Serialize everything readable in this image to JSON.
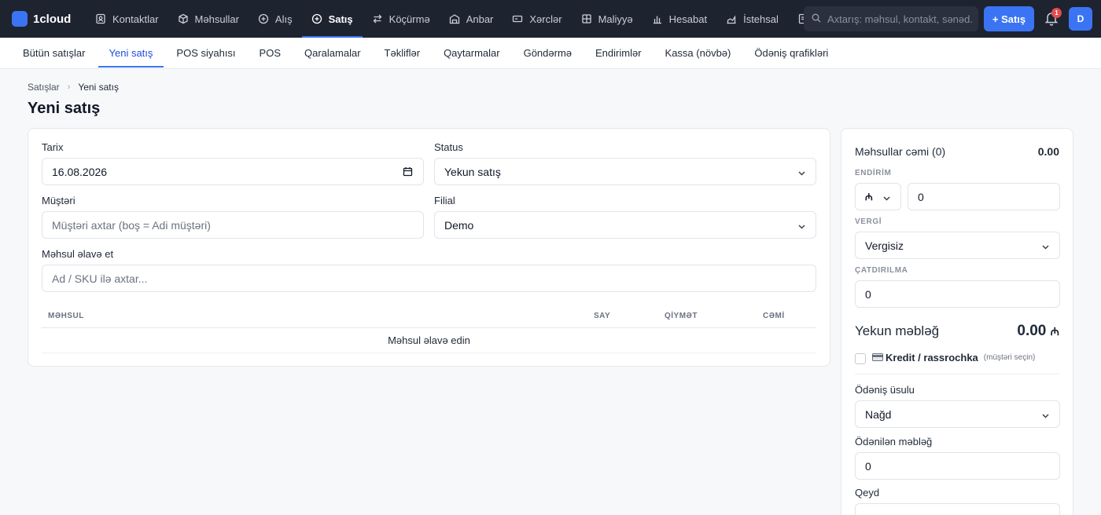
{
  "app": {
    "name": "1cloud"
  },
  "nav": [
    {
      "label": "Kontaktlar",
      "icon": "contacts-icon"
    },
    {
      "label": "Məhsullar",
      "icon": "box-icon"
    },
    {
      "label": "Alış",
      "icon": "plus-circle-icon"
    },
    {
      "label": "Satış",
      "icon": "plus-circle-icon",
      "active": true
    },
    {
      "label": "Köçürmə",
      "icon": "transfer-icon"
    },
    {
      "label": "Anbar",
      "icon": "warehouse-icon"
    },
    {
      "label": "Xərclər",
      "icon": "wallet-icon"
    },
    {
      "label": "Maliyyə",
      "icon": "grid-icon"
    },
    {
      "label": "Hesabat",
      "icon": "bar-chart-icon"
    },
    {
      "label": "İstehsal",
      "icon": "factory-icon"
    }
  ],
  "search": {
    "placeholder": "Axtarış: məhsul, kontakt, sənəd..."
  },
  "header": {
    "new_sale_label": "+ Satış",
    "notification_count": "1",
    "avatar_initial": "D"
  },
  "subnav": [
    {
      "label": "Bütün satışlar"
    },
    {
      "label": "Yeni satış",
      "active": true
    },
    {
      "label": "POS siyahısı"
    },
    {
      "label": "POS"
    },
    {
      "label": "Qaralamalar"
    },
    {
      "label": "Təkliflər"
    },
    {
      "label": "Qaytarmalar"
    },
    {
      "label": "Göndərmə"
    },
    {
      "label": "Endirimlər"
    },
    {
      "label": "Kassa (növbə)"
    },
    {
      "label": "Ödəniş qrafikləri"
    }
  ],
  "breadcrumb": {
    "parent": "Satışlar",
    "current": "Yeni satış"
  },
  "page": {
    "title": "Yeni satış"
  },
  "form": {
    "date_label": "Tarix",
    "date_value": "16.08.2026",
    "status_label": "Status",
    "status_value": "Yekun satış",
    "customer_label": "Müştəri",
    "customer_placeholder": "Müştəri axtar (boş = Adi müştəri)",
    "branch_label": "Filial",
    "branch_value": "Demo",
    "add_product_label": "Məhsul əlavə et",
    "add_product_placeholder": "Ad / SKU ilə axtar..."
  },
  "table": {
    "columns": [
      "MƏHSUL",
      "SAY",
      "QİYMƏT",
      "CƏMİ"
    ],
    "empty_text": "Məhsul əlavə edin"
  },
  "summary": {
    "products_total_label": "Məhsullar cəmi (0)",
    "products_total_value": "0.00",
    "discount_caption": "ENDİRİM",
    "discount_type": "₼",
    "discount_value": "0",
    "tax_caption": "VERGİ",
    "tax_value": "Vergisiz",
    "shipping_caption": "ÇATDIRILMA",
    "shipping_value": "0",
    "grand_total_label": "Yekun məbləğ",
    "grand_total_value": "0.00",
    "currency_symbol": "₼",
    "credit_label": "Kredit / rassrochka",
    "credit_hint": "(müştəri seçin)",
    "payment_method_label": "Ödəniş üsulu",
    "payment_method_value": "Nağd",
    "paid_amount_label": "Ödənilən məbləğ",
    "paid_amount_value": "0",
    "note_label": "Qeyd"
  },
  "colors": {
    "accent": "#3b74f3",
    "topbar": "#1e2330",
    "badge": "#e34d4d"
  }
}
